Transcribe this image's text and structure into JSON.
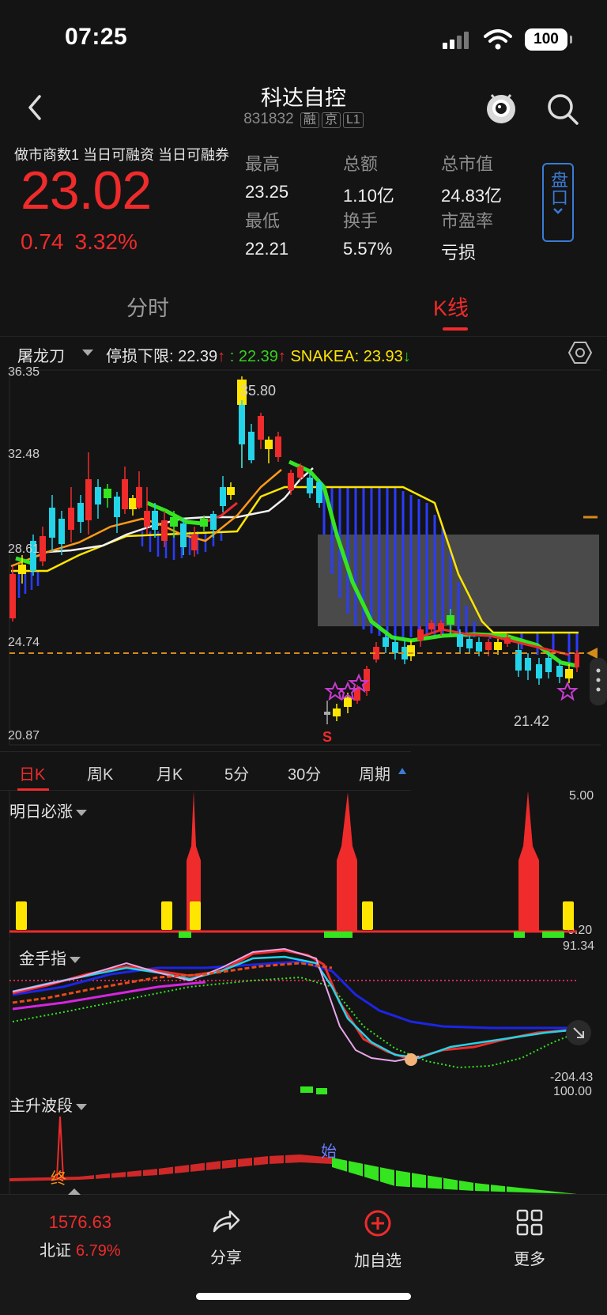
{
  "status_bar": {
    "time": "07:25",
    "battery": "100"
  },
  "nav": {
    "title": "科达自控",
    "code": "831832",
    "tags": [
      "融",
      "京",
      "L1"
    ]
  },
  "quote": {
    "rz_text": "做市商数1  当日可融资  当日可融券",
    "price": "23.02",
    "change": "0.74",
    "change_pct": "3.32%",
    "stats": [
      {
        "label": "最高",
        "value": "23.25"
      },
      {
        "label": "总额",
        "value": "1.10亿"
      },
      {
        "label": "总市值",
        "value": "24.83亿"
      },
      {
        "label": "最低",
        "value": "22.21"
      },
      {
        "label": "换手",
        "value": "5.57%"
      },
      {
        "label": "市盈率",
        "value": "亏损"
      }
    ],
    "pankou_label": "盘口"
  },
  "tabs": {
    "fenshi": "分时",
    "kline": "K线"
  },
  "indicator_header": {
    "name": "屠龙刀",
    "stop_text": "停损下限: 22.39",
    "green_text": ": 22.39",
    "snake_text": "SNAKEA: 23.93",
    "up_arrow": "↑",
    "down_arrow": "↓"
  },
  "main_chart": {
    "y_ticks": [
      "36.35",
      "32.48",
      "28.61",
      "24.74",
      "20.87"
    ],
    "high_label": "35.80",
    "low_label": "21.42",
    "sell_mark": "S"
  },
  "period_tabs": [
    "日K",
    "周K",
    "月K",
    "5分",
    "30分",
    "周期"
  ],
  "panel1": {
    "name": "明日必涨",
    "top": "5.00",
    "bottom": "0.20"
  },
  "panel2": {
    "name": "金手指",
    "top": "91.34",
    "bottom": "-204.43"
  },
  "panel3": {
    "name": "主升波段",
    "top": "100.00",
    "start_mark": "始",
    "end_mark": "终"
  },
  "bottom_bar": {
    "index_value": "1576.63",
    "index_name": "北证",
    "index_pct": "6.79%",
    "share": "分享",
    "add": "加自选",
    "more": "更多"
  },
  "colors": {
    "up": "#ef2b2b",
    "down": "#23d3e8",
    "accent": "#3a7bd5",
    "yellow": "#ffe600",
    "green": "#34d11e"
  }
}
